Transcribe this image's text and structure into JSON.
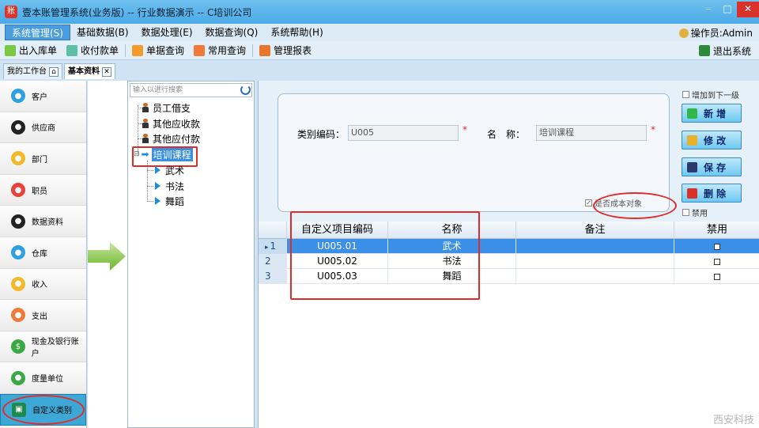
{
  "window": {
    "title": "壹本账管理系统(业务版) -- 行业数据演示 -- C培训公司",
    "app_icon": "账"
  },
  "menu": {
    "items": [
      "系统管理(S)",
      "基础数据(B)",
      "数据处理(E)",
      "数据查询(Q)",
      "系统帮助(H)"
    ],
    "operator": "操作员:Admin"
  },
  "toolbar": {
    "buttons": [
      "出入库单",
      "收付款单",
      "单据查询",
      "常用查询",
      "管理报表"
    ],
    "exit": "退出系统"
  },
  "tabs": [
    "我的工作台",
    "基本资料"
  ],
  "nav": {
    "items": [
      "客户",
      "供应商",
      "部门",
      "职员",
      "数据资料",
      "仓库",
      "收入",
      "支出",
      "现金及银行账户",
      "度量单位",
      "自定义类别"
    ],
    "active_index": 10
  },
  "tree": {
    "search_placeholder": "输入以进行搜索",
    "roots": [
      "员工借支",
      "其他应收款",
      "其他应付款"
    ],
    "selected": "培训课程",
    "children": [
      "武术",
      "书法",
      "舞蹈"
    ],
    "expand_symbol": "⊟"
  },
  "form": {
    "code_label": "类别编码：",
    "code_value": "U005",
    "name_label": "名　称：",
    "name_value": "培训课程",
    "required_mark": "*",
    "cost_checkbox_label": "是否成本对象",
    "cost_checked": true
  },
  "actions": {
    "add_next_level": "增加到下一级",
    "buttons": [
      "新 增",
      "修 改",
      "保 存",
      "删 除"
    ],
    "disable_label": "禁用"
  },
  "grid": {
    "headers": [
      "自定义项目编码",
      "名称",
      "备注",
      "禁用"
    ],
    "rows": [
      {
        "num": "1",
        "code": "U005.01",
        "name": "武术",
        "note": ""
      },
      {
        "num": "2",
        "code": "U005.02",
        "name": "书法",
        "note": ""
      },
      {
        "num": "3",
        "code": "U005.03",
        "name": "舞蹈",
        "note": ""
      }
    ],
    "selected_row": 0,
    "row_pointer": "▸"
  },
  "watermark": "西安科技",
  "colors": {
    "accent": "#3c8fe6",
    "highlight": "#e02b2b",
    "title_bar": "#4aaae6"
  }
}
